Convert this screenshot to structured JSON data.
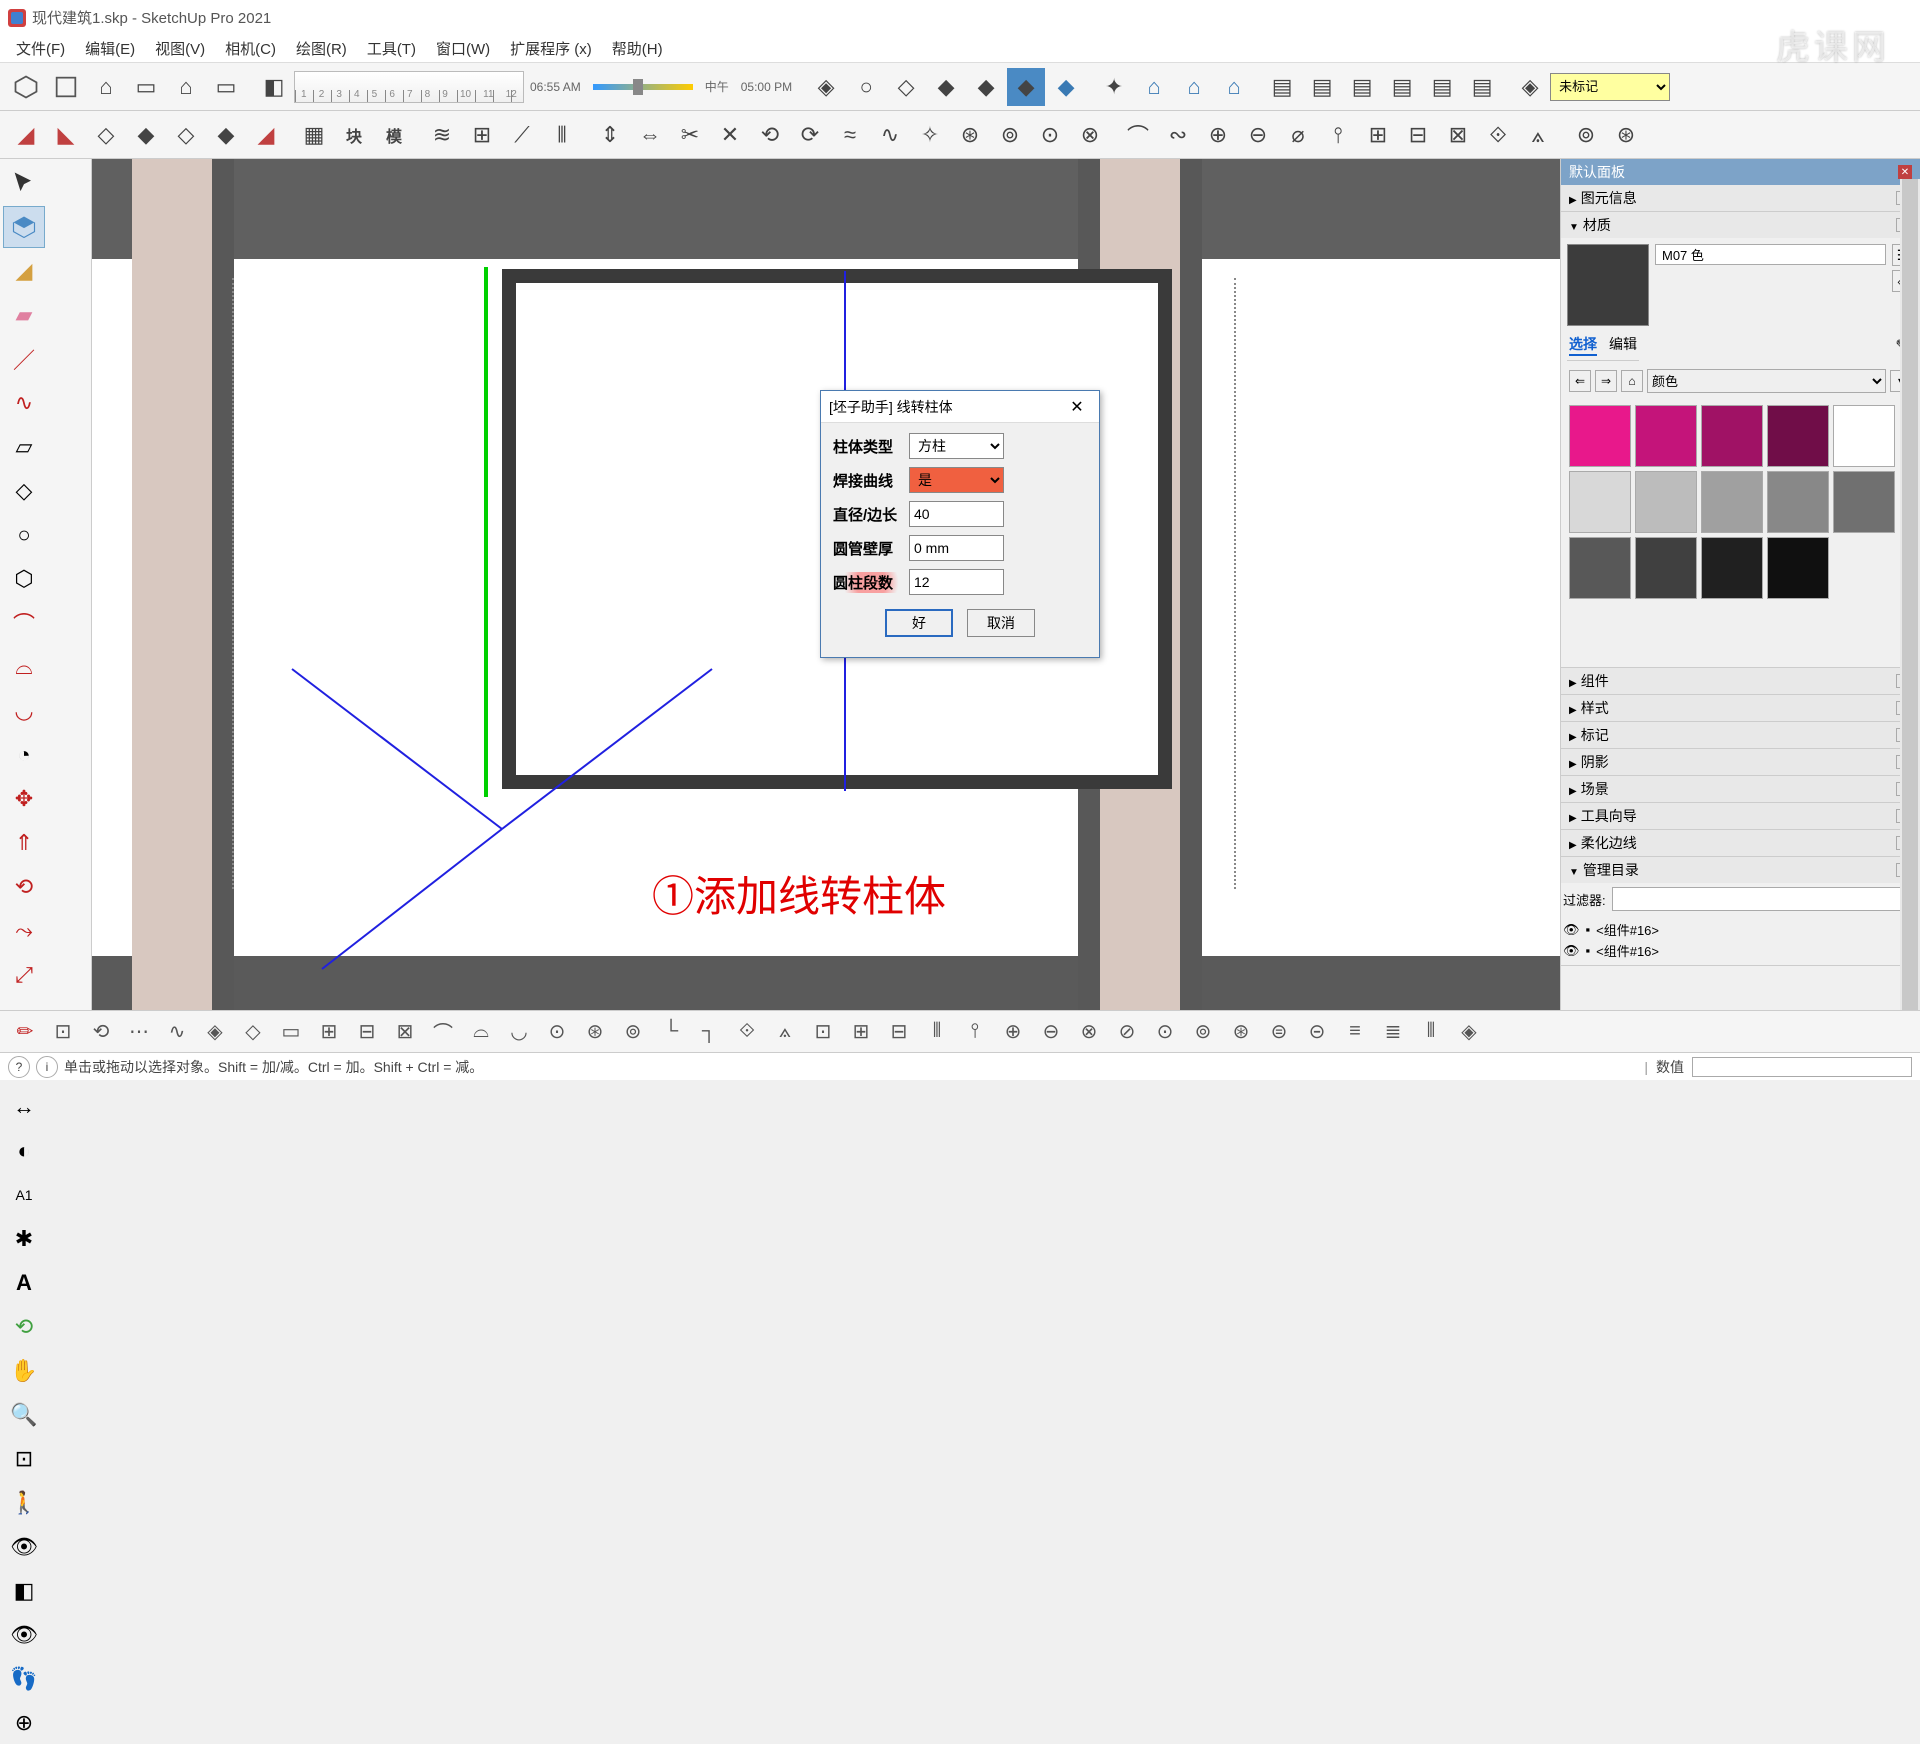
{
  "title": "现代建筑1.skp - SketchUp Pro 2021",
  "menu": [
    "文件(F)",
    "编辑(E)",
    "视图(V)",
    "相机(C)",
    "绘图(R)",
    "工具(T)",
    "窗口(W)",
    "扩展程序 (x)",
    "帮助(H)"
  ],
  "time": {
    "start": "06:55 AM",
    "mid": "中午",
    "end": "05:00 PM"
  },
  "layer_selected": "未标记",
  "ruler_marks": [
    "1",
    "2",
    "3",
    "4",
    "5",
    "6",
    "7",
    "8",
    "9",
    "10",
    "11",
    "12"
  ],
  "panels": {
    "header": "默认面板",
    "sections": [
      "图元信息",
      "材质",
      "组件",
      "样式",
      "标记",
      "阴影",
      "场景",
      "工具向导",
      "柔化边线",
      "管理目录"
    ]
  },
  "material": {
    "name": "M07 色",
    "tabs": [
      "选择",
      "编辑"
    ],
    "category": "颜色",
    "colors": [
      "#e8188b",
      "#c4147a",
      "#a01265",
      "#700d48",
      "#ffffff",
      "#d8d8d8",
      "#bcbcbc",
      "#a0a0a0",
      "#888888",
      "#707070",
      "#585858",
      "#404040",
      "#202020",
      "#101010"
    ]
  },
  "filter_label": "过滤器:",
  "outliner": [
    "<组件#16>",
    "<组件#16>"
  ],
  "dialog": {
    "title": "[坯子助手] 线转柱体",
    "rows": {
      "type_label": "柱体类型",
      "type_value": "方柱",
      "weld_label": "焊接曲线",
      "weld_value": "是",
      "diam_label": "直径/边长",
      "diam_value": "40",
      "wall_label": "圆管壁厚",
      "wall_value": "0 mm",
      "seg_label": "圆柱段数",
      "seg_value": "12"
    },
    "ok": "好",
    "cancel": "取消"
  },
  "viewport_text": "①添加线转柱体",
  "status": {
    "hint": "单击或拖动以选择对象。Shift = 加/减。Ctrl = 加。Shift + Ctrl = 减。",
    "measure_label": "数值"
  },
  "watermark": "虎课网"
}
